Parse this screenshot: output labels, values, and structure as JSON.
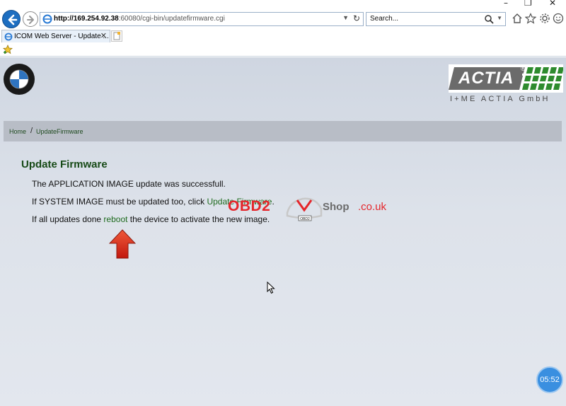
{
  "browser": {
    "address": {
      "host": "http://169.254.92.38",
      "path": ":60080/cgi-bin/updatefirmware.cgi"
    },
    "search": {
      "placeholder": "Search..."
    },
    "tab": {
      "title": "ICOM Web Server - Update ..."
    }
  },
  "header": {
    "brand_right": "ACTIA",
    "brand_right_sub": "I+ME ACTIA GmbH",
    "bmw_letters": "BMW"
  },
  "breadcrumb": {
    "home": "Home",
    "separator": "/",
    "current": "UpdateFirmware"
  },
  "content": {
    "title": "Update Firmware",
    "line1": "The APPLICATION IMAGE update was successfull.",
    "line2_prefix": "If SYSTEM IMAGE must be updated too, click ",
    "line2_link": "Update Firmware",
    "line2_suffix": ".",
    "line3_prefix": "If all updates done ",
    "line3_link": "reboot",
    "line3_suffix": " the device to activate the new image."
  },
  "watermark": {
    "obd": "OBD2",
    "shop": "Shop",
    "domain": ".co.uk",
    "badge": "OBD2"
  },
  "overlay": {
    "timer": "05:52"
  },
  "colors": {
    "accent_green": "#1f6b1f",
    "title_green": "#174a17",
    "watermark_red": "#e5262b",
    "timer_blue": "#3a8fe0"
  }
}
